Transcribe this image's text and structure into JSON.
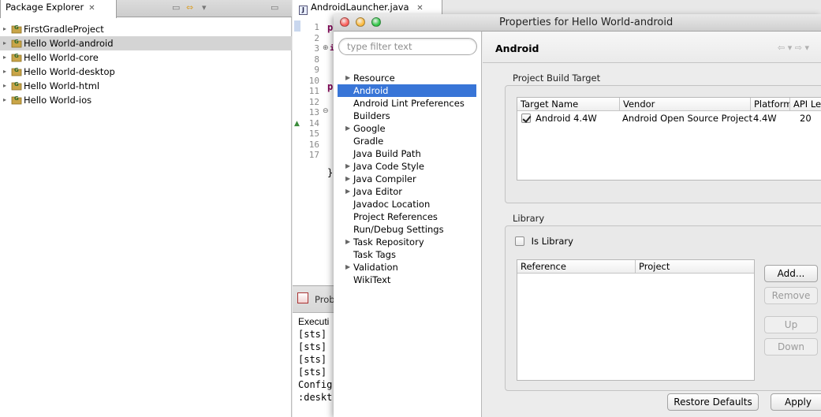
{
  "explorer": {
    "tab_label": "Package Explorer",
    "tab_close": "✕",
    "projects": [
      {
        "name": "FirstGradleProject",
        "selected": false
      },
      {
        "name": "Hello World-android",
        "selected": true
      },
      {
        "name": "Hello World-core",
        "selected": false
      },
      {
        "name": "Hello World-desktop",
        "selected": false
      },
      {
        "name": "Hello World-html",
        "selected": false
      },
      {
        "name": "Hello World-ios",
        "selected": false
      }
    ]
  },
  "editor": {
    "tab_label": "AndroidLauncher.java",
    "tab_close": "✕",
    "line_numbers": [
      "1",
      "2",
      "3",
      "8",
      "9",
      "10",
      "11",
      "12",
      "13",
      "14",
      "15",
      "16",
      "17"
    ],
    "code_fragments": {
      "l1": "p",
      "l3": "i",
      "l9": "p",
      "l16": "}"
    }
  },
  "console": {
    "tab_label": "Prob",
    "lines": [
      "Executi",
      "[sts]",
      "[sts]",
      "[sts]",
      "[sts]",
      "Config",
      ":deskt"
    ]
  },
  "dialog": {
    "title": "Properties for Hello World-android",
    "filter_placeholder": "type filter text",
    "nav_items": [
      {
        "label": "Resource",
        "expandable": true,
        "selected": false
      },
      {
        "label": "Android",
        "expandable": false,
        "selected": true
      },
      {
        "label": "Android Lint Preferences",
        "expandable": false,
        "selected": false
      },
      {
        "label": "Builders",
        "expandable": false,
        "selected": false
      },
      {
        "label": "Google",
        "expandable": true,
        "selected": false
      },
      {
        "label": "Gradle",
        "expandable": false,
        "selected": false
      },
      {
        "label": "Java Build Path",
        "expandable": false,
        "selected": false
      },
      {
        "label": "Java Code Style",
        "expandable": true,
        "selected": false
      },
      {
        "label": "Java Compiler",
        "expandable": true,
        "selected": false
      },
      {
        "label": "Java Editor",
        "expandable": true,
        "selected": false
      },
      {
        "label": "Javadoc Location",
        "expandable": false,
        "selected": false
      },
      {
        "label": "Project References",
        "expandable": false,
        "selected": false
      },
      {
        "label": "Run/Debug Settings",
        "expandable": false,
        "selected": false
      },
      {
        "label": "Task Repository",
        "expandable": true,
        "selected": false
      },
      {
        "label": "Task Tags",
        "expandable": false,
        "selected": false
      },
      {
        "label": "Validation",
        "expandable": true,
        "selected": false
      },
      {
        "label": "WikiText",
        "expandable": false,
        "selected": false
      }
    ],
    "page_title": "Android",
    "nav_arrows": "⇦ ▾ ⇨ ▾",
    "build_target": {
      "group_label": "Project Build Target",
      "columns": [
        "Target Name",
        "Vendor",
        "Platform",
        "API Le"
      ],
      "rows": [
        {
          "checked": true,
          "name": "Android 4.4W",
          "vendor": "Android Open Source Project",
          "platform": "4.4W",
          "api": "20"
        }
      ]
    },
    "library": {
      "group_label": "Library",
      "is_library_label": "Is Library",
      "is_library_checked": false,
      "columns": [
        "Reference",
        "Project"
      ],
      "buttons": {
        "add": "Add...",
        "remove": "Remove",
        "up": "Up",
        "down": "Down"
      }
    },
    "restore_defaults": "Restore Defaults",
    "apply": "Apply"
  },
  "colors": {
    "selection": "#3875d7",
    "traffic_close": "#fc605b",
    "traffic_min": "#fdbc40",
    "traffic_max": "#34c84a"
  }
}
